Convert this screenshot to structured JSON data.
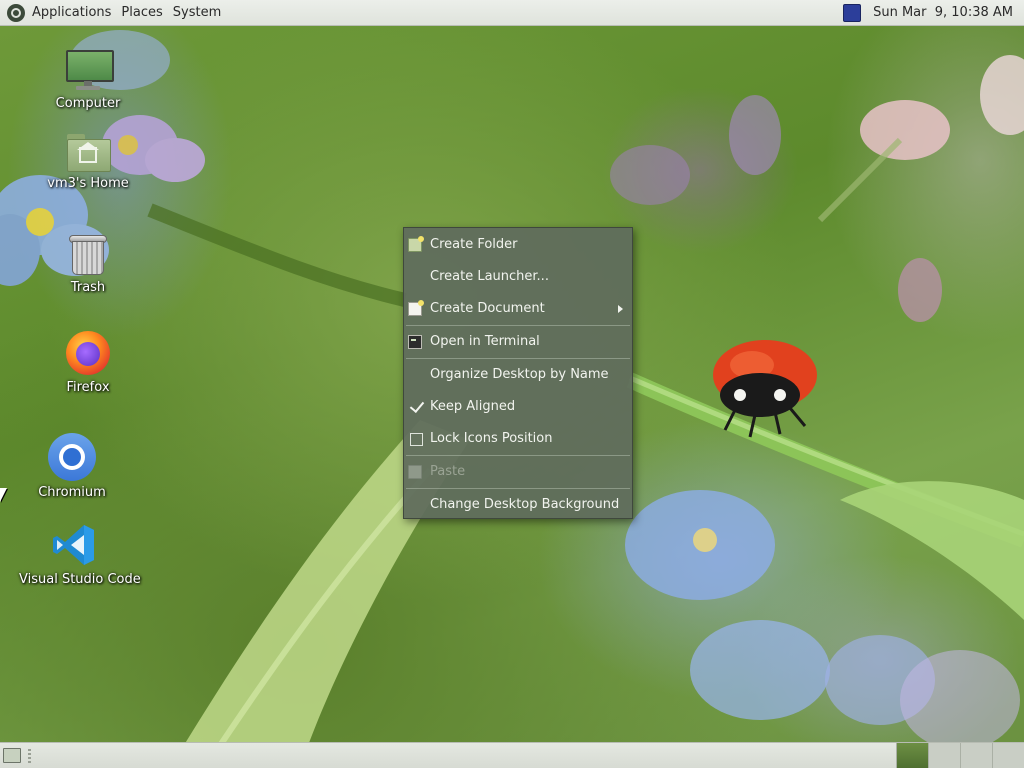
{
  "top_panel": {
    "menus": [
      "Applications",
      "Places",
      "System"
    ],
    "clock": "Sun Mar  9, 10:38 AM"
  },
  "desktop_icons": [
    {
      "label": "Computer",
      "icon": "computer-icon"
    },
    {
      "label": "vm3's Home",
      "icon": "home-folder-icon"
    },
    {
      "label": "Trash",
      "icon": "trash-icon"
    },
    {
      "label": "Firefox",
      "icon": "firefox-icon"
    },
    {
      "label": "Chromium",
      "icon": "chromium-icon"
    },
    {
      "label": "Visual Studio Code",
      "icon": "vscode-icon"
    }
  ],
  "context_menu": {
    "items": [
      {
        "label": "Create Folder",
        "icon": "new-folder-icon"
      },
      {
        "label": "Create Launcher...",
        "icon": ""
      },
      {
        "label": "Create Document",
        "icon": "new-document-icon",
        "submenu": true
      },
      {
        "label": "Open in Terminal",
        "icon": "terminal-icon"
      },
      {
        "label": "Organize Desktop by Name",
        "icon": ""
      },
      {
        "label": "Keep Aligned",
        "icon": "check-icon",
        "checked": true
      },
      {
        "label": "Lock Icons Position",
        "icon": "checkbox-icon",
        "checked": false
      },
      {
        "label": "Paste",
        "icon": "paste-icon",
        "disabled": true
      },
      {
        "label": "Change Desktop Background",
        "icon": ""
      }
    ]
  },
  "bottom_panel": {
    "workspaces": 4,
    "active_workspace": 1
  },
  "colors": {
    "menu_bg": "#606c5c",
    "panel_bg": "#e4e8e1",
    "accent": "#6d8f44"
  }
}
